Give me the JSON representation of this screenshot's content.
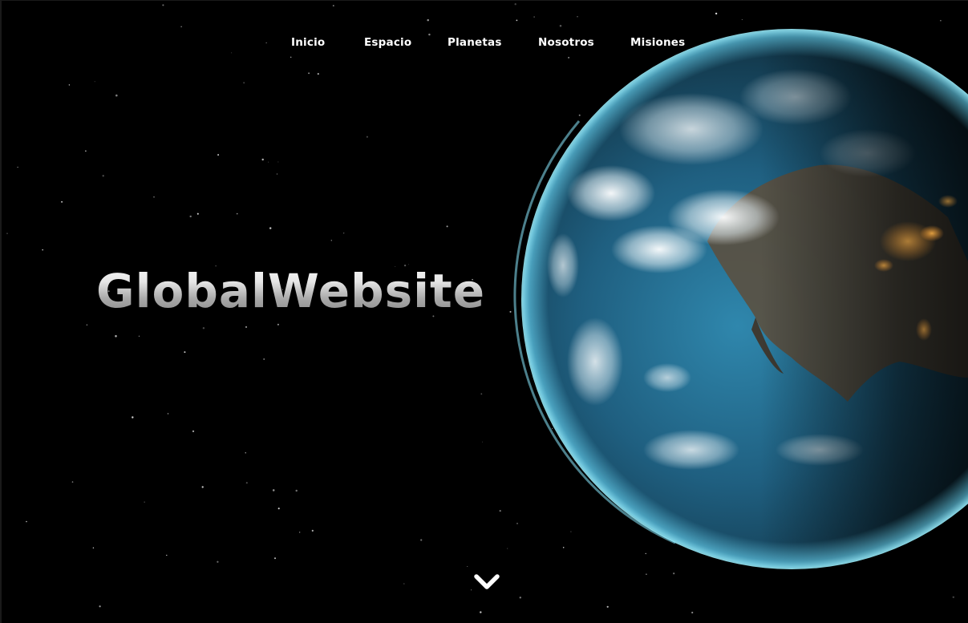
{
  "nav": {
    "items": [
      "Inicio",
      "Espacio",
      "Planetas",
      "Nosotros",
      "Misiones"
    ]
  },
  "hero": {
    "title": "GlobalWebsite"
  },
  "icons": {
    "scroll": "chevron-down-icon",
    "planet": "earth-image"
  },
  "colors": {
    "background": "#000000",
    "nav_text": "#ffffff",
    "ocean": "#2a7ea6",
    "atmosphere": "#5fd6ff"
  }
}
